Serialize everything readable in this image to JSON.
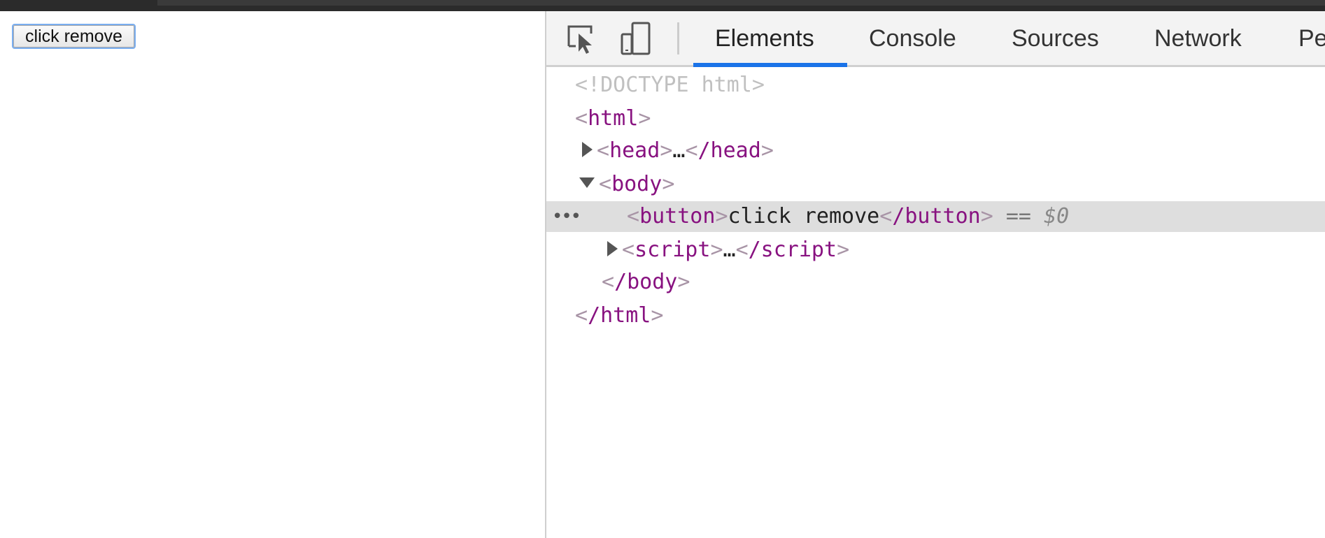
{
  "page": {
    "button_label": "click remove"
  },
  "devtools": {
    "icons": [
      "inspect-element-icon",
      "device-toggle-icon"
    ],
    "tabs": [
      "Elements",
      "Console",
      "Sources",
      "Network",
      "Pe"
    ],
    "active_tab": "Elements",
    "accent_color": "#1a73e8",
    "tree": {
      "doctype": "<!DOCTYPE html>",
      "html_open": "html",
      "head_tag": "head",
      "ellipsis": "…",
      "head_close": "/head",
      "body_tag": "body",
      "button_tag": "button",
      "button_text": "click remove",
      "button_close": "/button",
      "equals": "==",
      "dollar_ref": "$0",
      "script_tag": "script",
      "script_close": "/script",
      "body_close": "/body",
      "html_close": "/html",
      "row_menu": "•••"
    }
  }
}
